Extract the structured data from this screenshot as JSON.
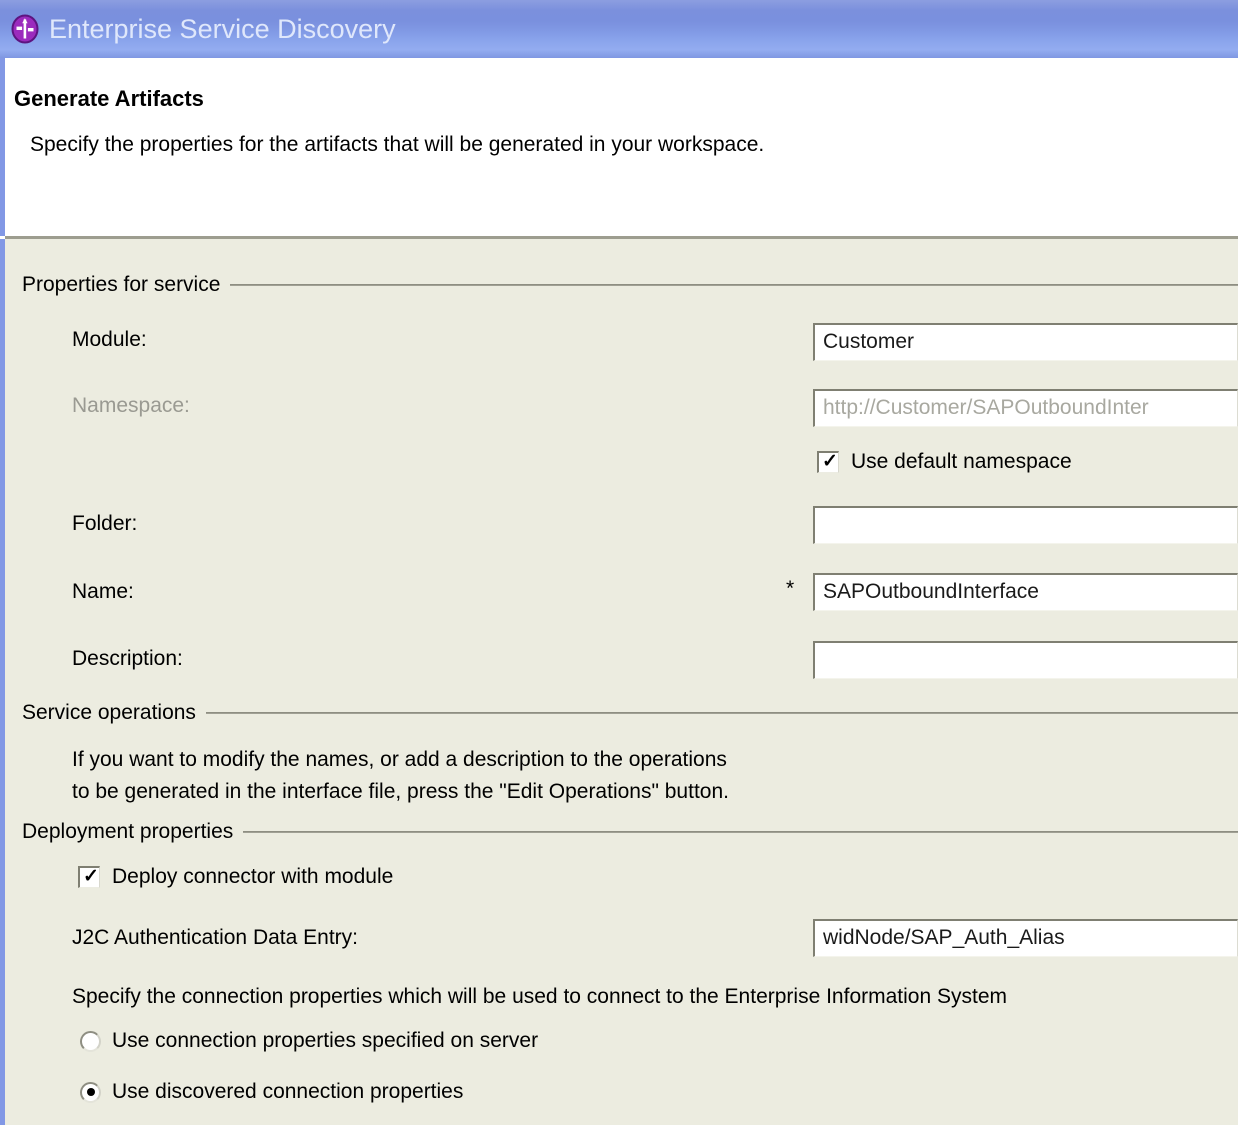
{
  "window": {
    "title": "Enterprise Service Discovery",
    "icon": "service-discovery-icon"
  },
  "header": {
    "title": "Generate Artifacts",
    "subtitle": "Specify the properties for the artifacts that will be generated in your workspace."
  },
  "groups": {
    "properties_for_service": {
      "legend": "Properties for service",
      "fields": {
        "module": {
          "label": "Module:",
          "value": "Customer"
        },
        "namespace": {
          "label": "Namespace:",
          "value": "http://Customer/SAPOutboundInter",
          "disabled": true
        },
        "use_default_namespace": {
          "label": "Use default namespace",
          "checked": true
        },
        "folder": {
          "label": "Folder:",
          "value": ""
        },
        "name": {
          "label": "Name:",
          "value": "SAPOutboundInterface",
          "required_marker": "*"
        },
        "description": {
          "label": "Description:",
          "value": ""
        }
      }
    },
    "service_operations": {
      "legend": "Service operations",
      "text_line_1": "If you want to modify the names, or add a description to the operations",
      "text_line_2": "to be generated in the interface file, press the \"Edit Operations\" button."
    },
    "deployment_properties": {
      "legend": "Deployment properties",
      "deploy_connector": {
        "label": "Deploy connector with module",
        "checked": true
      },
      "j2c_auth": {
        "label": "J2C Authentication Data Entry:",
        "value": "widNode/SAP_Auth_Alias"
      },
      "connection_text": "Specify the connection properties which will be used to connect to the Enterprise Information System",
      "radios": [
        {
          "label": "Use connection properties specified on server",
          "selected": false
        },
        {
          "label": "Use discovered connection properties",
          "selected": true
        }
      ]
    }
  },
  "colors": {
    "titlebar_blue": "#7b90dd",
    "accent_bar": "#8298e5",
    "content_background": "#ecece0",
    "icon_purple": "#9b2bbd",
    "disabled_text": "#9a9a92"
  }
}
